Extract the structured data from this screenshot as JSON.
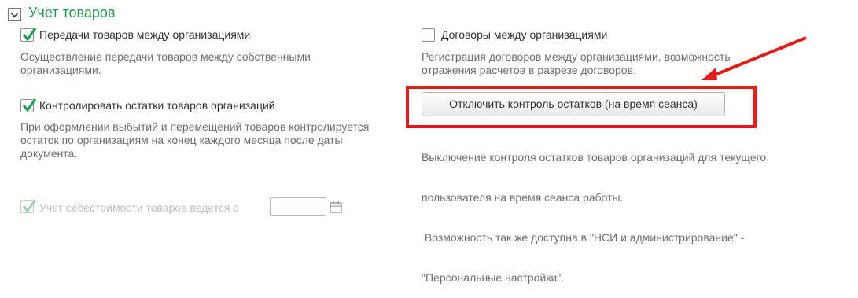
{
  "section": {
    "title": "Учет товаров"
  },
  "options": {
    "transfers": {
      "label": "Передачи товаров между организациями",
      "checked": true,
      "description_lines": [
        "Осуществление передачи товаров между собственными",
        "организациями."
      ]
    },
    "contracts": {
      "label": "Договоры между организациями",
      "checked": false,
      "description_lines": [
        "Регистрация договоров между организациями, возможность",
        "отражения расчетов  в разрезе договоров."
      ]
    },
    "control_stock": {
      "label": "Контролировать остатки товаров организаций",
      "checked": true,
      "description_lines": [
        "При оформлении выбытий и перемещений товаров контролируется",
        "остаток по организациям на конец каждого месяца после даты",
        "документа."
      ]
    },
    "cost_accounting": {
      "label": "Учет себестоимости товаров ведется с",
      "checked": true,
      "disabled": true,
      "date_value": ""
    }
  },
  "disable_control": {
    "button_label": "Отключить контроль остатков (на время сеанса)",
    "description_lines": [
      "Выключение контроля остатков товаров организаций для текущего",
      "пользователя на время сеанса работы.",
      " Возможность так же доступна в \"НСИ и администрирование\" -",
      "\"Персональные настройки\"."
    ]
  },
  "colors": {
    "accent": "#1e9e4e",
    "highlight": "#e21b1b",
    "check": "#1e9e4e"
  },
  "icons": {
    "section_toggle": "chevron-down-icon",
    "checkmark": "checkmark-icon",
    "calendar": "calendar-icon"
  }
}
